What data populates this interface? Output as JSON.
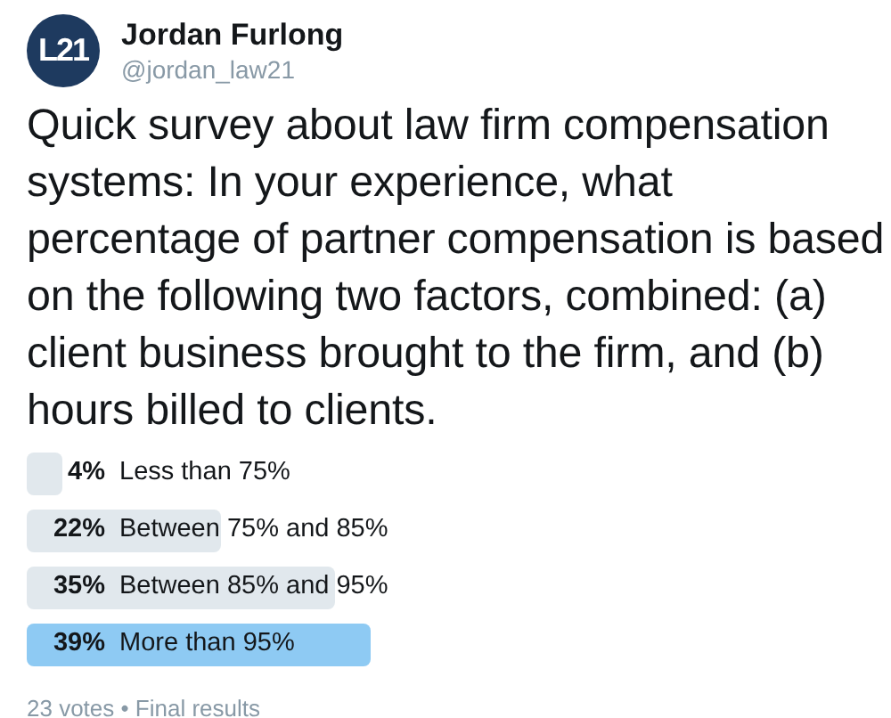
{
  "author": {
    "avatar_text": "L21",
    "name": "Jordan Furlong",
    "handle": "@jordan_law21"
  },
  "text": "Quick survey about law firm compensation systems: In your experience, what percentage of partner compensation is based on the following two factors, combined: (a) client business brought to the firm, and (b) hours billed to clients.",
  "poll": {
    "options": [
      {
        "percent": "4%",
        "label": "Less than 75%",
        "winner": false
      },
      {
        "percent": "22%",
        "label": "Between 75% and 85%",
        "winner": false
      },
      {
        "percent": "35%",
        "label": "Between 85% and 95%",
        "winner": false
      },
      {
        "percent": "39%",
        "label": "More than 95%",
        "winner": true
      }
    ],
    "summary": "23 votes • Final results"
  }
}
